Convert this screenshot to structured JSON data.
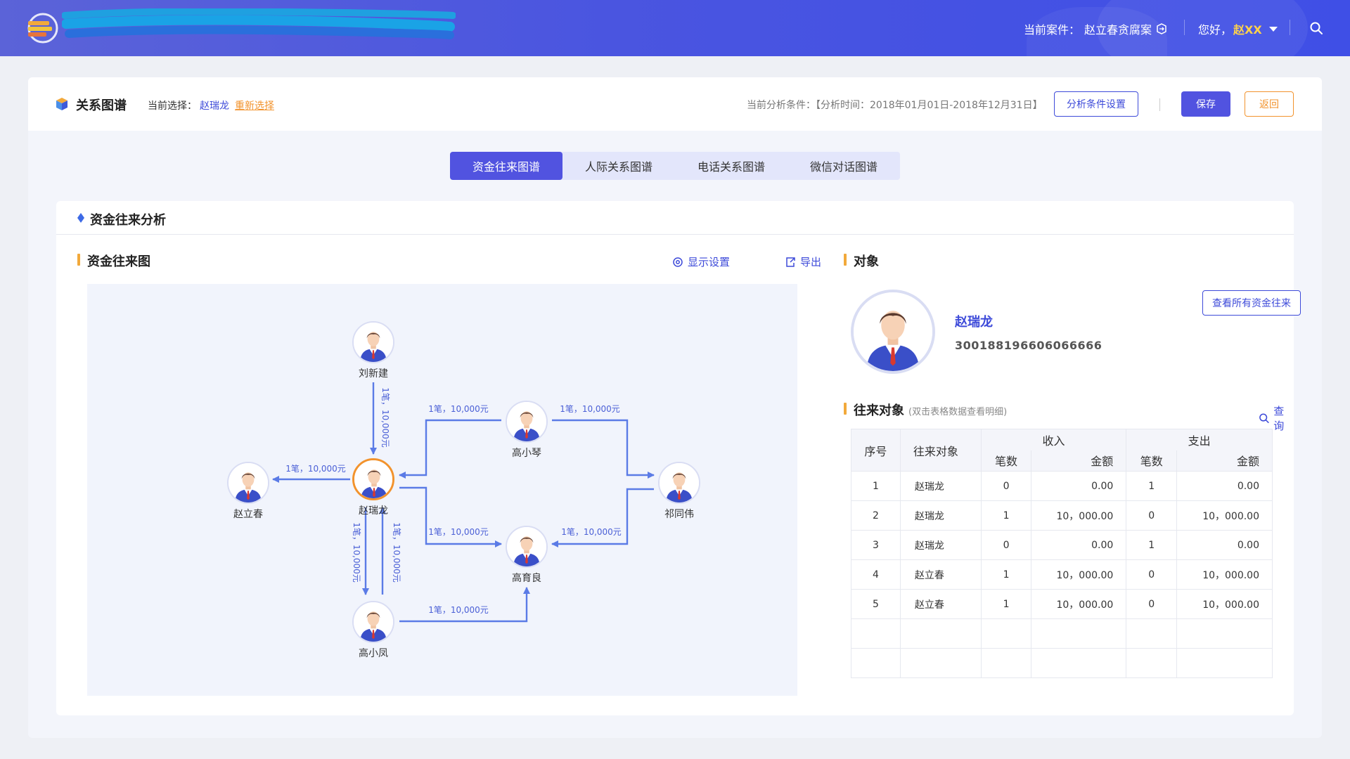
{
  "header": {
    "system_title": "",
    "case_label": "当前案件：",
    "case_name": "赵立春贪腐案",
    "greeting": "您好，",
    "username": "赵XX"
  },
  "page": {
    "title": "关系图谱",
    "selection_label": "当前选择：",
    "selection_value": "赵瑞龙",
    "reselect": "重新选择",
    "condition_text": "当前分析条件：【分析时间：2018年01月01日-2018年12月31日】",
    "condition_button": "分析条件设置",
    "save_button": "保存",
    "back_button": "返回"
  },
  "tabs": [
    {
      "label": "资金往来图谱",
      "active": true
    },
    {
      "label": "人际关系图谱",
      "active": false
    },
    {
      "label": "电话关系图谱",
      "active": false
    },
    {
      "label": "微信对话图谱",
      "active": false
    }
  ],
  "panel": {
    "title": "资金往来分析",
    "graph_title": "资金往来图",
    "display_settings": "显示设置",
    "export": "导出",
    "object_title": "对象",
    "view_all_button": "查看所有资金往来",
    "counterparty_title": "往来对象",
    "counterparty_hint": "(双击表格数据查看明细)",
    "query": "查询"
  },
  "graph": {
    "nodes": [
      {
        "id": "liuxinjian",
        "name": "刘新建"
      },
      {
        "id": "zhaoruilong",
        "name": "赵瑞龙",
        "focus": true
      },
      {
        "id": "zhaolichun",
        "name": "赵立春"
      },
      {
        "id": "gaoxiaoqin",
        "name": "高小琴"
      },
      {
        "id": "gaoyuliang",
        "name": "高育良"
      },
      {
        "id": "qitongwei",
        "name": "祁同伟"
      },
      {
        "id": "gaoxiaofeng",
        "name": "高小凤"
      }
    ],
    "edges": [
      {
        "from": "liuxinjian",
        "to": "zhaoruilong",
        "label": "1笔，10,000元"
      },
      {
        "from": "zhaoruilong",
        "to": "zhaolichun",
        "label": "1笔，10,000元"
      },
      {
        "from": "gaoxiaoqin",
        "to": "zhaoruilong",
        "label": "1笔，10,000元"
      },
      {
        "from": "gaoxiaoqin",
        "to": "qitongwei",
        "label": "1笔，10,000元"
      },
      {
        "from": "zhaoruilong",
        "to": "gaoyuliang",
        "label": "1笔，10,000元"
      },
      {
        "from": "qitongwei",
        "to": "gaoyuliang",
        "label": "1笔，10,000元"
      },
      {
        "from": "zhaoruilong",
        "to": "gaoxiaofeng",
        "label": "1笔，10,000元"
      },
      {
        "from": "gaoxiaofeng",
        "to": "zhaoruilong",
        "label": "1笔，10,000元"
      },
      {
        "from": "gaoxiaofeng",
        "to": "gaoyuliang",
        "label": "1笔，10,000元"
      }
    ]
  },
  "object": {
    "name": "赵瑞龙",
    "id_number": "300188196606066666"
  },
  "table": {
    "headers": {
      "index": "序号",
      "counterparty": "往来对象",
      "income": "收入",
      "expense": "支出",
      "count": "笔数",
      "amount": "金额"
    },
    "rows": [
      {
        "index": "1",
        "name": "赵瑞龙",
        "in_count": "0",
        "in_amount": "0.00",
        "out_count": "1",
        "out_amount": "0.00"
      },
      {
        "index": "2",
        "name": "赵瑞龙",
        "in_count": "1",
        "in_amount": "10，000.00",
        "out_count": "0",
        "out_amount": "10，000.00"
      },
      {
        "index": "3",
        "name": "赵瑞龙",
        "in_count": "0",
        "in_amount": "0.00",
        "out_count": "1",
        "out_amount": "0.00"
      },
      {
        "index": "4",
        "name": "赵立春",
        "in_count": "1",
        "in_amount": "10，000.00",
        "out_count": "0",
        "out_amount": "10，000.00"
      },
      {
        "index": "5",
        "name": "赵立春",
        "in_count": "1",
        "in_amount": "10，000.00",
        "out_count": "0",
        "out_amount": "10，000.00"
      },
      {
        "index": "",
        "name": "",
        "in_count": "",
        "in_amount": "",
        "out_count": "",
        "out_amount": ""
      },
      {
        "index": "",
        "name": "",
        "in_count": "",
        "in_amount": "",
        "out_count": "",
        "out_amount": ""
      }
    ]
  },
  "colors": {
    "primary": "#5153e0",
    "accent_orange": "#f2932d",
    "edge": "#5b7be6",
    "header_start": "#5b63d8",
    "header_end": "#3f4fe6"
  }
}
